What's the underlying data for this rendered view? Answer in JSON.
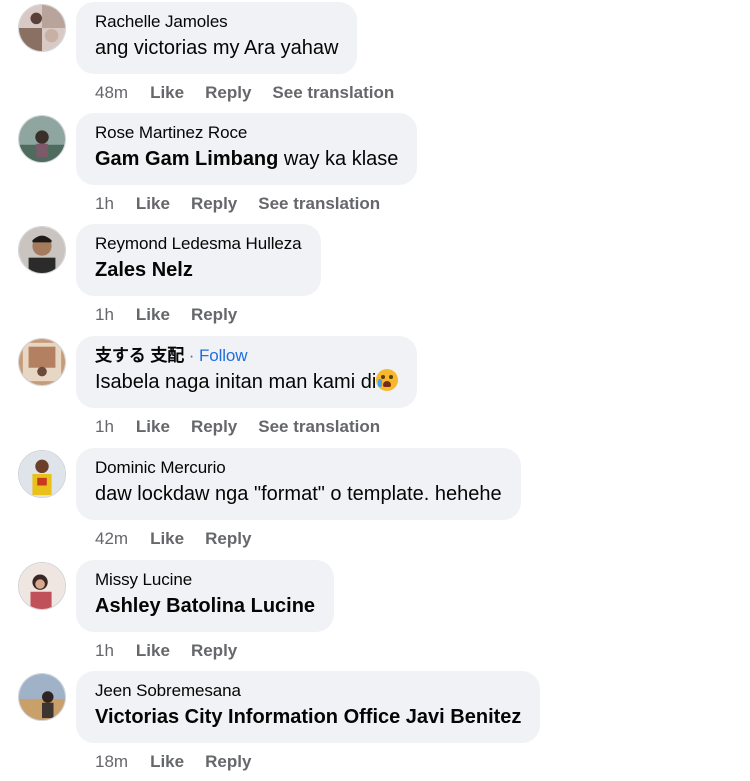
{
  "actions": {
    "like": "Like",
    "reply": "Reply",
    "see_translation": "See translation"
  },
  "comments": [
    {
      "author": "Rachelle Jamoles",
      "text": "ang victorias my Ara yahaw",
      "time": "48m",
      "avatar": "profile-photo"
    },
    {
      "author": "Rose Martinez Roce",
      "tag": "Gam Gam Limbang",
      "text": " way ka klase",
      "time": "1h",
      "avatar": "profile-photo"
    },
    {
      "author": "Reymond Ledesma Hulleza",
      "tag": "Zales Nelz",
      "time": "1h",
      "avatar": "profile-photo"
    },
    {
      "author": "支する 支配",
      "separator": " · ",
      "follow": "Follow",
      "text": "Isabela naga initan man kami di",
      "emoji": "crying-face-emoji",
      "time": "1h",
      "avatar": "profile-photo"
    },
    {
      "author": "Dominic Mercurio",
      "text": "daw lockdaw nga \"format\" o template. hehehe",
      "time": "42m",
      "avatar": "profile-photo"
    },
    {
      "author": "Missy Lucine",
      "tag": "Ashley Batolina Lucine",
      "time": "1h",
      "avatar": "profile-photo"
    },
    {
      "author": "Jeen Sobremesana",
      "tag": "Victorias City Information Office Javi Benitez",
      "time": "18m",
      "avatar": "profile-photo"
    }
  ],
  "colors": {
    "bubble": "#f0f2f5",
    "follow": "#216fdb",
    "meta": "#65676b"
  }
}
